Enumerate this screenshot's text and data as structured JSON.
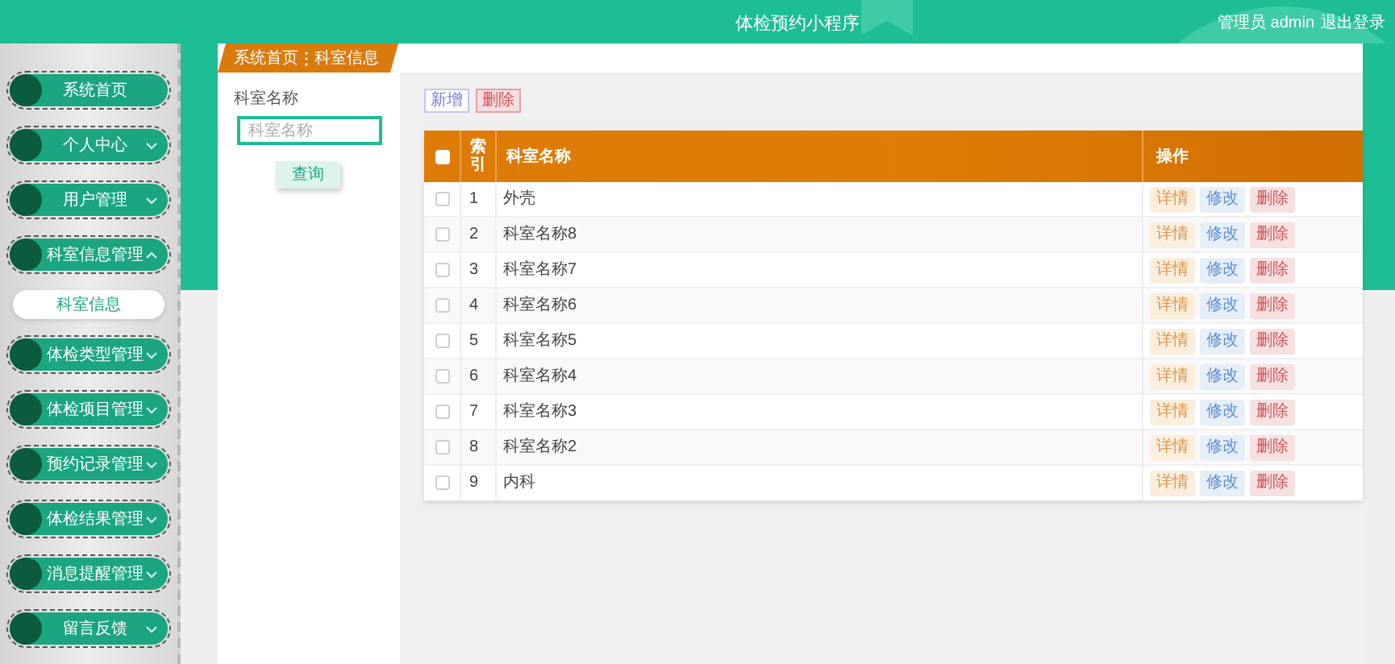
{
  "header": {
    "title": "体检预约小程序",
    "user": "管理员 admin",
    "logout": "退出登录"
  },
  "sidebar": {
    "items": [
      {
        "label": "系统首页",
        "kind": "link"
      },
      {
        "label": "个人中心",
        "kind": "menu",
        "expanded": false
      },
      {
        "label": "用户管理",
        "kind": "menu",
        "expanded": false
      },
      {
        "label": "科室信息管理",
        "kind": "menu",
        "expanded": true,
        "children": [
          {
            "label": "科室信息",
            "selected": true
          }
        ]
      },
      {
        "label": "体检类型管理",
        "kind": "menu",
        "expanded": false
      },
      {
        "label": "体检项目管理",
        "kind": "menu",
        "expanded": false
      },
      {
        "label": "预约记录管理",
        "kind": "menu",
        "expanded": false
      },
      {
        "label": "体检结果管理",
        "kind": "menu",
        "expanded": false
      },
      {
        "label": "消息提醒管理",
        "kind": "menu",
        "expanded": false
      },
      {
        "label": "留言反馈",
        "kind": "menu",
        "expanded": false
      }
    ]
  },
  "breadcrumb": [
    "系统首页",
    "科室信息"
  ],
  "search": {
    "label": "科室名称",
    "placeholder": "科室名称",
    "button": "查询"
  },
  "toolbar": {
    "add": "新增",
    "delete": "删除"
  },
  "table": {
    "select_all": {
      "checked": false
    },
    "columns": [
      "索引",
      "科室名称",
      "操作"
    ],
    "rows": [
      {
        "checked": false,
        "index": "1",
        "name": "外壳",
        "actions": [
          "详情",
          "修改",
          "删除"
        ]
      },
      {
        "checked": false,
        "index": "2",
        "name": "科室名称8",
        "actions": [
          "详情",
          "修改",
          "删除"
        ]
      },
      {
        "checked": false,
        "index": "3",
        "name": "科室名称7",
        "actions": [
          "详情",
          "修改",
          "删除"
        ]
      },
      {
        "checked": false,
        "index": "4",
        "name": "科室名称6",
        "actions": [
          "详情",
          "修改",
          "删除"
        ]
      },
      {
        "checked": false,
        "index": "5",
        "name": "科室名称5",
        "actions": [
          "详情",
          "修改",
          "删除"
        ]
      },
      {
        "checked": false,
        "index": "6",
        "name": "科室名称4",
        "actions": [
          "详情",
          "修改",
          "删除"
        ]
      },
      {
        "checked": false,
        "index": "7",
        "name": "科室名称3",
        "actions": [
          "详情",
          "修改",
          "删除"
        ]
      },
      {
        "checked": false,
        "index": "8",
        "name": "科室名称2",
        "actions": [
          "详情",
          "修改",
          "删除"
        ]
      },
      {
        "checked": false,
        "index": "9",
        "name": "内科",
        "actions": [
          "详情",
          "修改",
          "删除"
        ]
      }
    ]
  }
}
